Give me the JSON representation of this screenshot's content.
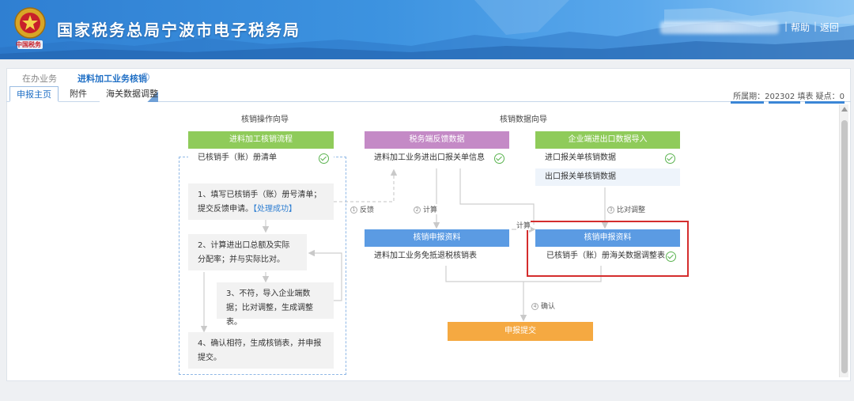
{
  "header": {
    "site_title": "国家税务总局宁波市电子税务局",
    "emblem_text": "中国税务",
    "help": "帮助",
    "separator": "|",
    "back": "返回"
  },
  "tabs_top": [
    {
      "label": "在办业务"
    },
    {
      "label": "进料加工业务核销"
    }
  ],
  "tabs_sub": [
    {
      "label": "申报主页"
    },
    {
      "label": "附件"
    },
    {
      "label": "海关数据调整"
    }
  ],
  "period_info": "所属期：202302   填表   疑点：0",
  "flow": {
    "left_title": "核销操作向导",
    "right_title": "核销数据向导",
    "left_header": "进料加工核销流程",
    "left_item": "已核销手（账）册清单",
    "steps": {
      "s1_text": "1、填写已核销手（账）册号清单；提交反馈申请。",
      "s1_status": "【处理成功】",
      "s2_text": "2、计算进出口总额及实际分配率；并与实际比对。",
      "s3_text": "3、不符，导入企业端数据；比对调整，生成调整表。",
      "s4_text": "4、确认相符，生成核销表，并申报提交。"
    },
    "feedback_header": "税务端反馈数据",
    "feedback_item": "进料加工业务进出口报关单信息",
    "enterprise_header": "企业端进出口数据导入",
    "enterprise_item1": "进口报关单核销数据",
    "enterprise_item2": "出口报关单核销数据",
    "declare_left_header": "核销申报资料",
    "declare_left_item": "进料加工业务免抵退税核销表",
    "declare_right_header": "核销申报资料",
    "declare_right_item": "已核销手（账）册海关数据调整表",
    "submit_button": "申报提交",
    "edge_labels": {
      "l1_num": "1",
      "l1": "反馈",
      "l2_num": "2",
      "l2": "计算",
      "l3_num": "3",
      "l3": "比对调整",
      "l4_num": "4",
      "l4": "确认",
      "calc": "计算"
    }
  },
  "colors": {
    "green": "#8fcb5a",
    "purple": "#c48ac6",
    "blue": "#5b9be3",
    "orange": "#f5a941",
    "highlight": "#d42d2d"
  }
}
